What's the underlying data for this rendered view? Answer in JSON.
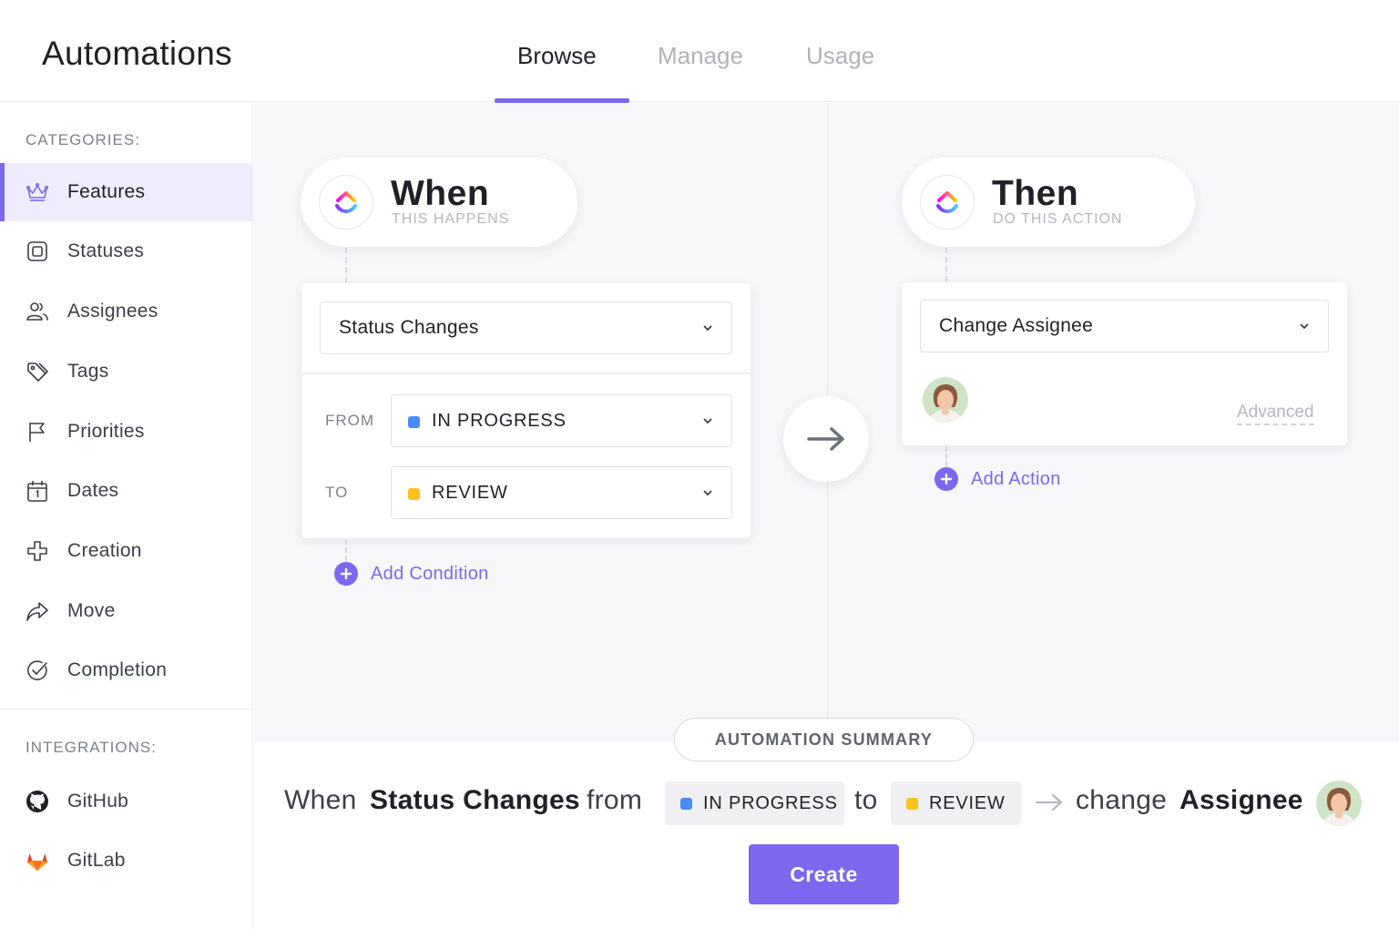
{
  "app": {
    "title": "Automations"
  },
  "tabs": [
    {
      "label": "Browse",
      "active": true
    },
    {
      "label": "Manage",
      "active": false
    },
    {
      "label": "Usage",
      "active": false
    }
  ],
  "sidebar": {
    "categories_label": "CATEGORIES:",
    "categories": [
      {
        "label": "Features",
        "icon": "crown-icon",
        "active": true
      },
      {
        "label": "Statuses",
        "icon": "status-square-icon"
      },
      {
        "label": "Assignees",
        "icon": "people-icon"
      },
      {
        "label": "Tags",
        "icon": "tag-icon"
      },
      {
        "label": "Priorities",
        "icon": "flag-icon"
      },
      {
        "label": "Dates",
        "icon": "calendar-icon"
      },
      {
        "label": "Creation",
        "icon": "plus-outline-icon"
      },
      {
        "label": "Move",
        "icon": "share-arrow-icon"
      },
      {
        "label": "Completion",
        "icon": "check-circle-icon"
      }
    ],
    "integrations_label": "INTEGRATIONS:",
    "integrations": [
      {
        "label": "GitHub",
        "icon": "github-icon"
      },
      {
        "label": "GitLab",
        "icon": "gitlab-icon"
      }
    ]
  },
  "trigger": {
    "title": "When",
    "subtitle": "THIS HAPPENS",
    "select_value": "Status Changes",
    "from_label": "FROM",
    "from_value": "IN PROGRESS",
    "to_label": "TO",
    "to_value": "REVIEW",
    "add_condition": "Add Condition"
  },
  "action": {
    "title": "Then",
    "subtitle": "DO THIS ACTION",
    "select_value": "Change Assignee",
    "advanced": "Advanced",
    "add_action": "Add Action"
  },
  "summary": {
    "pill": "AUTOMATION SUMMARY",
    "when": "When",
    "trigger": "Status Changes",
    "from": "from",
    "from_status": "IN PROGRESS",
    "to": "to",
    "to_status": "REVIEW",
    "change": "change",
    "target": "Assignee"
  },
  "create_label": "Create",
  "colors": {
    "accent": "#7b68ee",
    "in_progress": "#4a8cf7",
    "review": "#fcc21b",
    "active_bg": "#efedfd"
  }
}
